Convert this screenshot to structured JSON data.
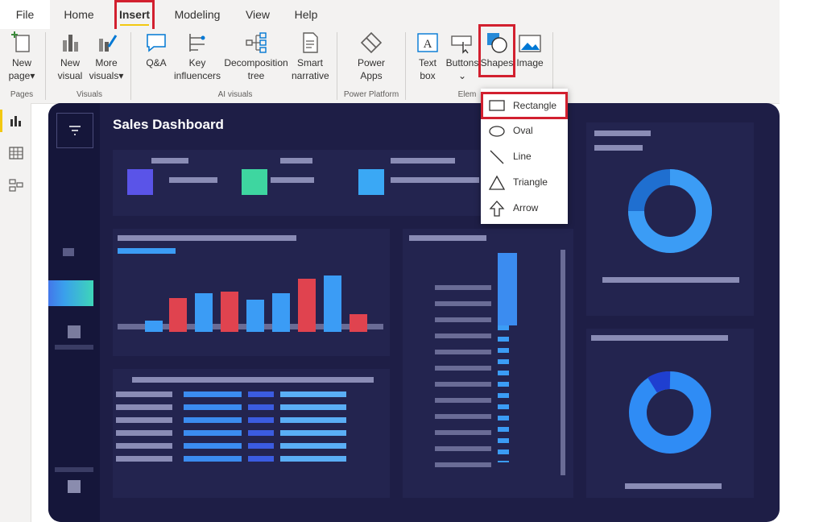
{
  "menu": {
    "file": "File",
    "tabs": [
      {
        "label": "Home"
      },
      {
        "label": "Insert"
      },
      {
        "label": "Modeling"
      },
      {
        "label": "View"
      },
      {
        "label": "Help"
      }
    ]
  },
  "ribbon": {
    "new_page": {
      "line1": "New",
      "line2": "page"
    },
    "new_visual": {
      "line1": "New",
      "line2": "visual"
    },
    "more_visuals": {
      "line1": "More",
      "line2": "visuals"
    },
    "qa": {
      "line1": "Q&A"
    },
    "key_influencers": {
      "line1": "Key",
      "line2": "influencers"
    },
    "decomposition_tree": {
      "line1": "Decomposition",
      "line2": "tree"
    },
    "smart_narrative": {
      "line1": "Smart",
      "line2": "narrative"
    },
    "power_apps": {
      "line1": "Power",
      "line2": "Apps"
    },
    "text_box": {
      "line1": "Text",
      "line2": "box"
    },
    "buttons": {
      "line1": "Buttons"
    },
    "shapes": {
      "line1": "Shapes"
    },
    "image": {
      "line1": "Image"
    },
    "groups": {
      "pages": "Pages",
      "visuals": "Visuals",
      "ai_visuals": "AI visuals",
      "power_platform": "Power Platform",
      "elements": "Elem"
    }
  },
  "canvas": {
    "title": "Sales Dashboard"
  },
  "shapes_menu": {
    "items": [
      {
        "label": "Rectangle"
      },
      {
        "label": "Oval"
      },
      {
        "label": "Line"
      },
      {
        "label": "Triangle"
      },
      {
        "label": "Arrow"
      }
    ]
  },
  "colors": {
    "highlight": "#d2202f",
    "accent_yellow": "#f2c811",
    "canvas_bg": "#1e1e46",
    "bar_red": "#e0434f",
    "bar_blue": "#3b9cf5"
  }
}
